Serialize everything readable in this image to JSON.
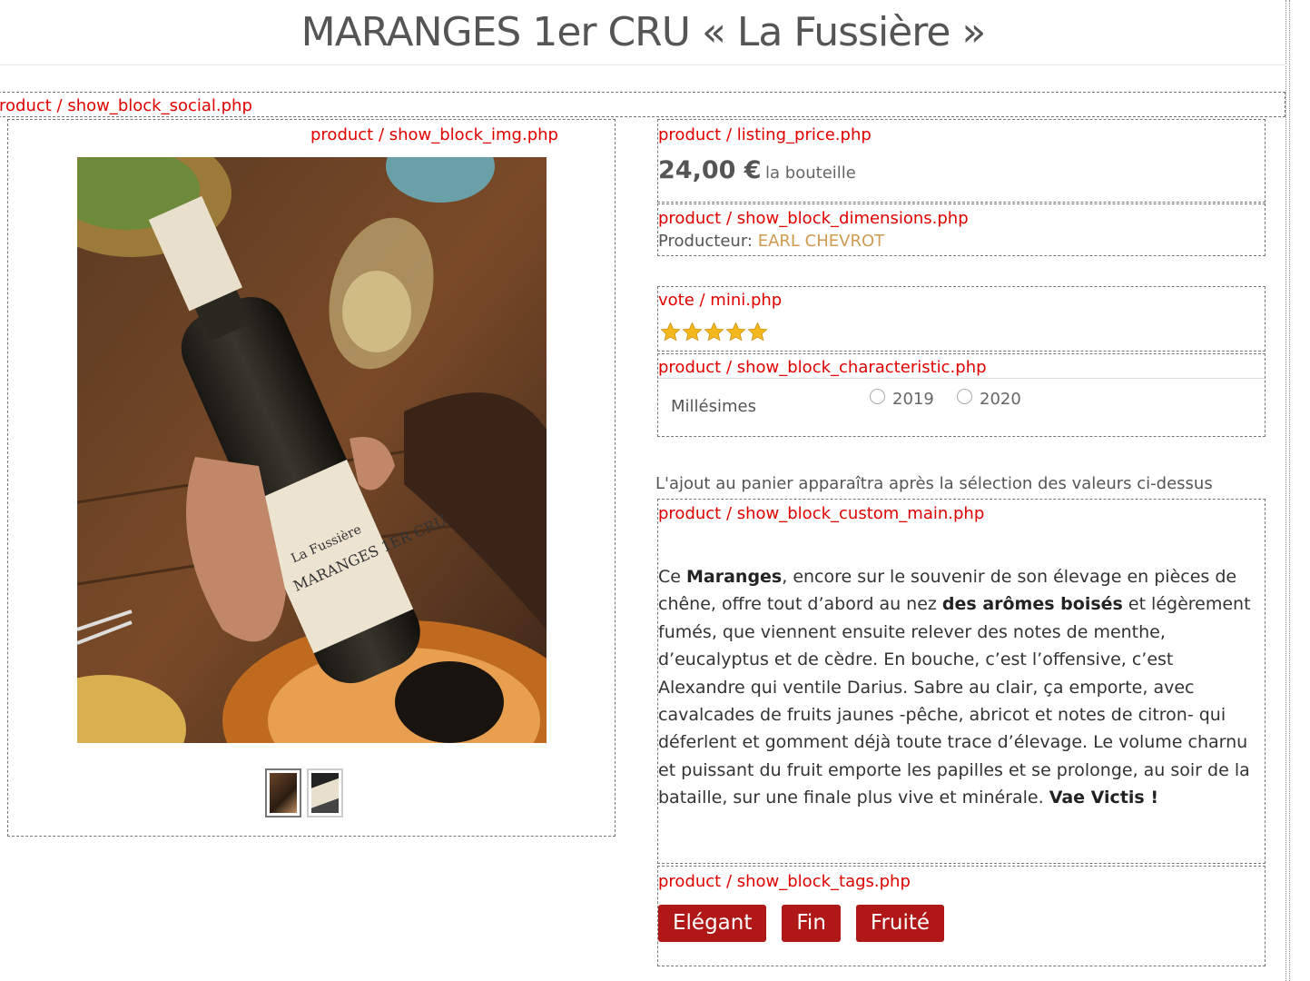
{
  "page": {
    "title": "MARANGES 1er CRU « La Fussière »"
  },
  "debug_labels": {
    "social": "roduct / show_block_social.php",
    "img": "product / show_block_img.php",
    "price": "product / listing_price.php",
    "dimensions": "product / show_block_dimensions.php",
    "vote": "vote / mini.php",
    "characteristic": "product / show_block_characteristic.php",
    "custom": "product / show_block_custom_main.php",
    "tags": "product / show_block_tags.php"
  },
  "price": {
    "amount": "24,00 €",
    "unit": "la bouteille"
  },
  "producer": {
    "label": "Producteur:",
    "name": "EARL CHEVROT"
  },
  "rating": {
    "stars": 5,
    "max": 5,
    "color": "#f5b81c"
  },
  "characteristics": {
    "label": "Millésimes",
    "options": [
      "2019",
      "2020"
    ],
    "selected": null
  },
  "cart_note": "L'ajout au panier apparaîtra après la sélection des valeurs ci-dessus",
  "description": {
    "p1": "Ce ",
    "b1": "Maranges",
    "p2": ", encore sur le souvenir de son élevage en pièces de chêne, offre tout d’abord au nez ",
    "b2": "des arômes boisés",
    "p3": " et légèrement fumés, que viennent ensuite relever des notes de menthe, d’eucalyptus et de cèdre. En bouche, c’est l’offensive, c’est Alexandre qui ventile Darius. Sabre au clair, ça emporte, avec cavalcades de fruits jaunes -pêche, abricot et notes de citron- qui déferlent et gomment déjà toute trace d’élevage. Le volume charnu et puissant du fruit emporte les papilles et se prolonge, au soir de la bataille, sur une finale plus vive et minérale. ",
    "b3": "Vae Victis !"
  },
  "tags": [
    "Elégant",
    "Fin",
    "Fruité"
  ],
  "colors": {
    "debug_red": "#e00000",
    "tag_bg": "#b01818",
    "producer_link": "#d09a50"
  }
}
